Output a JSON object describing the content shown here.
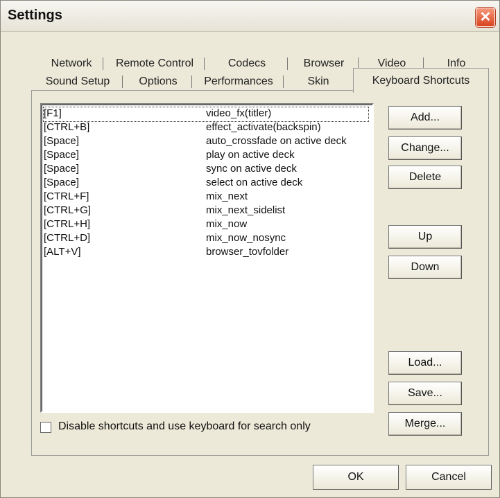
{
  "window": {
    "title": "Settings",
    "close_label": "✕"
  },
  "tabs": {
    "row1": [
      "Network",
      "Remote Control",
      "Codecs",
      "Browser",
      "Video",
      "Info"
    ],
    "row2": [
      "Sound Setup",
      "Options",
      "Performances",
      "Skin",
      "Keyboard Shortcuts"
    ],
    "active": "Keyboard Shortcuts"
  },
  "shortcuts": [
    {
      "key": "[F1]",
      "action": "video_fx(titler)"
    },
    {
      "key": "[CTRL+B]",
      "action": "effect_activate(backspin)"
    },
    {
      "key": "[Space]",
      "action": "auto_crossfade on active deck"
    },
    {
      "key": "[Space]",
      "action": "play on active deck"
    },
    {
      "key": "[Space]",
      "action": "sync on active deck"
    },
    {
      "key": "[Space]",
      "action": "select on active deck"
    },
    {
      "key": "[CTRL+F]",
      "action": "mix_next"
    },
    {
      "key": "[CTRL+G]",
      "action": "mix_next_sidelist"
    },
    {
      "key": "[CTRL+H]",
      "action": "mix_now"
    },
    {
      "key": "[CTRL+D]",
      "action": "mix_now_nosync"
    },
    {
      "key": "[ALT+V]",
      "action": "browser_tovfolder"
    }
  ],
  "buttons": {
    "add": "Add...",
    "change": "Change...",
    "delete": "Delete",
    "up": "Up",
    "down": "Down",
    "load": "Load...",
    "save": "Save...",
    "merge": "Merge..."
  },
  "disable_checkbox": {
    "label": "Disable shortcuts and use keyboard for search only",
    "checked": false
  },
  "footer": {
    "ok": "OK",
    "cancel": "Cancel"
  }
}
